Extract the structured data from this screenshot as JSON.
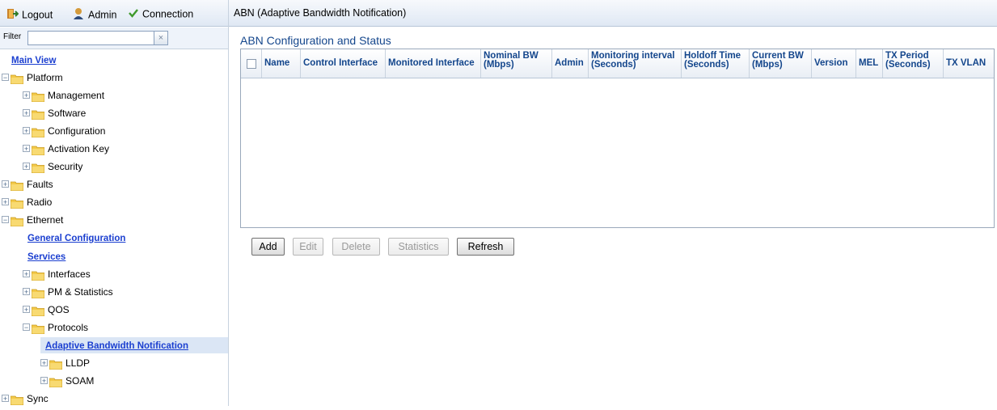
{
  "topbar": {
    "logout": "Logout",
    "admin": "Admin",
    "connection": "Connection"
  },
  "filter": {
    "label": "Filter",
    "value": "",
    "clear": "×"
  },
  "tree": {
    "main_view": "Main View",
    "platform": "Platform",
    "management": "Management",
    "software": "Software",
    "configuration": "Configuration",
    "activation_key": "Activation Key",
    "security": "Security",
    "faults": "Faults",
    "radio": "Radio",
    "ethernet": "Ethernet",
    "general_configuration": "General Configuration",
    "services": "Services",
    "interfaces": "Interfaces",
    "pm_statistics": "PM & Statistics",
    "qos": "QOS",
    "protocols": "Protocols",
    "abn": "Adaptive Bandwidth Notification",
    "lldp": "LLDP",
    "soam": "SOAM",
    "sync": "Sync"
  },
  "page": {
    "title": "ABN (Adaptive Bandwidth Notification)",
    "section": "ABN Configuration and Status"
  },
  "table": {
    "columns": [
      "Name",
      "Control Interface",
      "Monitored Interface",
      "Nominal BW (Mbps)",
      "Admin",
      "Monitoring interval (Seconds)",
      "Holdoff Time (Seconds)",
      "Current BW (Mbps)",
      "Version",
      "MEL",
      "TX Period (Seconds)",
      "TX VLAN"
    ],
    "rows": []
  },
  "buttons": {
    "add": "Add",
    "edit": "Edit",
    "delete": "Delete",
    "statistics": "Statistics",
    "refresh": "Refresh"
  },
  "colors": {
    "section_title": "#14468c",
    "link": "#1b3fd0",
    "folder": "#f3c94a"
  }
}
